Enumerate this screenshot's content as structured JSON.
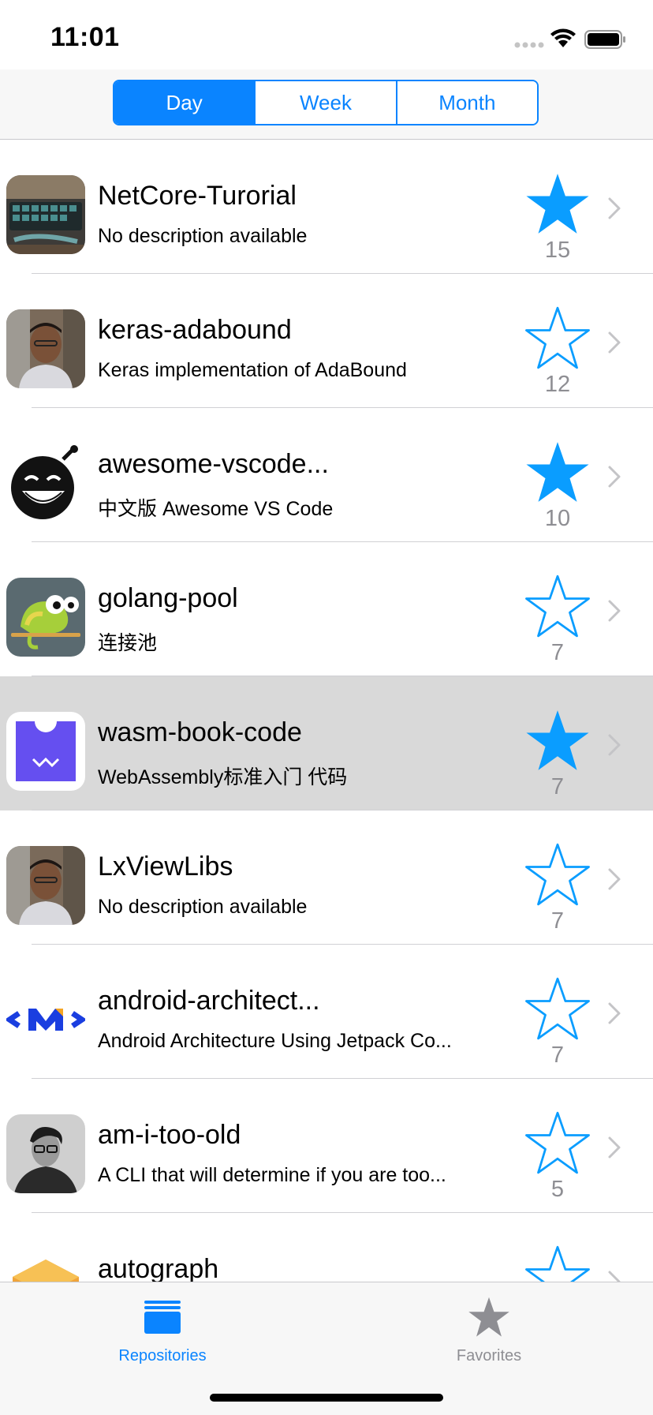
{
  "status_bar": {
    "time": "11:01"
  },
  "segments": [
    {
      "label": "Day",
      "active": true
    },
    {
      "label": "Week",
      "active": false
    },
    {
      "label": "Month",
      "active": false
    }
  ],
  "colors": {
    "accent": "#0a84ff",
    "star": "#0a9dff",
    "count": "#8e8e93",
    "highlight": "#d9d9d9"
  },
  "repos": [
    {
      "name": "NetCore-Turorial",
      "desc": "No description available",
      "stars": "15",
      "favorited": true,
      "avatar": "keyboard-photo"
    },
    {
      "name": "keras-adabound",
      "desc": "Keras implementation of AdaBound",
      "stars": "12",
      "favorited": false,
      "avatar": "person-photo"
    },
    {
      "name": "awesome-vscode...",
      "desc": "中文版 Awesome VS Code",
      "stars": "10",
      "favorited": true,
      "avatar": "bomb-face-avatar"
    },
    {
      "name": "golang-pool",
      "desc": "连接池",
      "stars": "7",
      "favorited": false,
      "avatar": "chameleon-avatar"
    },
    {
      "name": "wasm-book-code",
      "desc": "WebAssembly标准入门 代码",
      "stars": "7",
      "favorited": true,
      "highlighted": true,
      "avatar": "webassembly-logo"
    },
    {
      "name": "LxViewLibs",
      "desc": "No description available",
      "stars": "7",
      "favorited": false,
      "avatar": "person-photo"
    },
    {
      "name": "android-architect...",
      "desc": "Android Architecture Using Jetpack Co...",
      "stars": "7",
      "favorited": false,
      "avatar": "m-logo"
    },
    {
      "name": "am-i-too-old",
      "desc": "A CLI that will determine if you are too...",
      "stars": "5",
      "favorited": false,
      "avatar": "person-photo-bw"
    },
    {
      "name": "autograph",
      "desc": "",
      "stars": "",
      "favorited": false,
      "avatar": "tensorflow-logo"
    }
  ],
  "tabs": [
    {
      "label": "Repositories",
      "icon": "stack-icon",
      "active": true
    },
    {
      "label": "Favorites",
      "icon": "star-icon",
      "active": false
    }
  ]
}
